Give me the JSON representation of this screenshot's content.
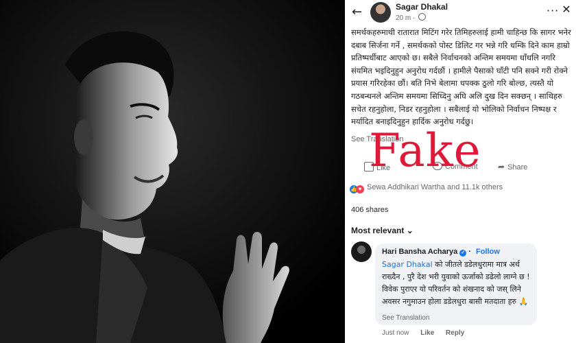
{
  "post": {
    "author": "Sagar Dhakal",
    "time": "20 m",
    "body": "समर्थकहरुमाथी रातारात मिटिंग गरेर तिमिहरुलाई हामी चाहिन्छ कि सागर भनेर दबाब सिर्जना गर्ने , समर्थकको पोस्ट डिलिट गर भन्ने गरि धम्कि दिने काम हाम्रो प्रतिष्पर्धीबाट आएको छ। सबैले निर्वाचनको अन्तिम समयमा धाँधलि नगरि संयमित भइदिनुहुन अनुरोध गर्दछौं । हामीले पैसाको घाँटी पनि सक्ने गरी रोक्ने प्रयास गरिरहेका छौं। बति निभे बेलामा धपक्क ठुलो गरि बोल्छ, त्यस्तै यो गठबन्धनले अन्तिम समयमा सिध्दिनु अघि अलि दुख दिन सक्छन् । साथिहरु सचेत रहनुहोला, निडर रहनुहोला । सबैलाई यो भोलिको निर्वाचन निष्पक्ष र मर्यादित बनाइदिनुहुन हार्दिक अनुरोध गर्दछु।",
    "see_translation": "See Translation",
    "like_label": "Like",
    "comment_label": "Comment",
    "share_label": "Share",
    "reactions_text": "Sewa Addhikari Wartha and 11.1k others",
    "shares_count": "406 shares",
    "sort_label": "Most relevant ⌄"
  },
  "comment": {
    "author": "Hari Bansha Acharya",
    "follow_label": "Follow",
    "mention": "Sagar Dhakal",
    "text": " को जीतले डडेलधुरामा मात्र अर्थ राख्दैन , पुरै देश भरी युवाको ऊर्जाको डढेलो लाग्ने छ ! विवेक पुराएर यो परिवर्तन को शंखनाद को जस् लिने अवसर नगुमाउन होला डडेलधुरा बासी मतदाता हरु 🙏",
    "see_translation": "See Translation",
    "time": "Just now",
    "like_label": "Like",
    "reply_label": "Reply"
  },
  "overlay": {
    "stamp": "Fake",
    "stamp_color": "#e0193a"
  },
  "icons": {
    "back": "arrow-left-icon",
    "more": "more-dots-icon",
    "close": "close-icon",
    "globe": "globe-icon",
    "like": "thumbs-up-icon",
    "comment": "comment-icon",
    "share": "share-icon",
    "verified": "verified-badge-icon"
  }
}
